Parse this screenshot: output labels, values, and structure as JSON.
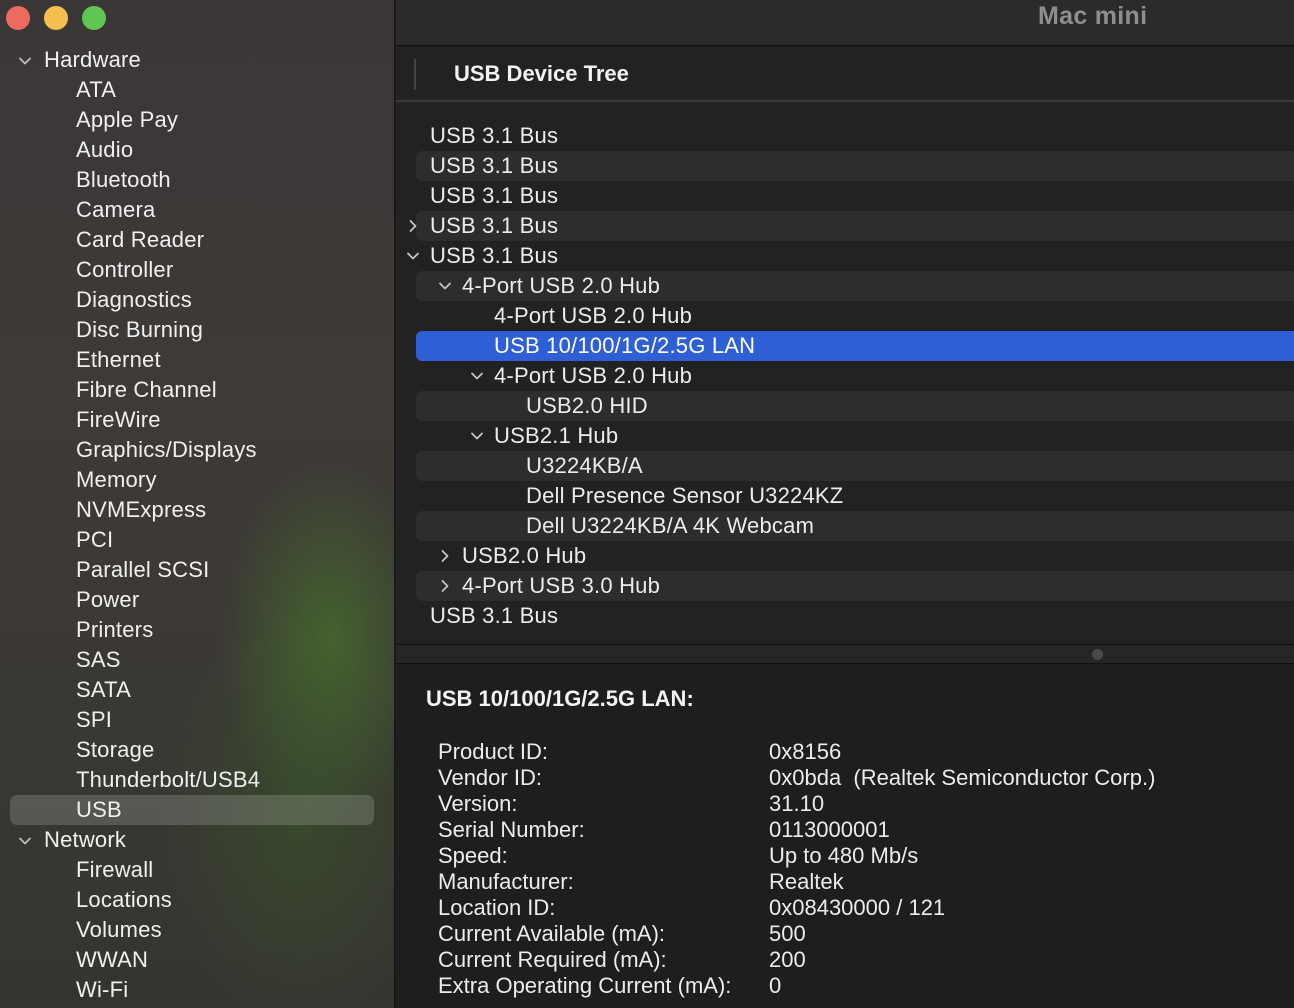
{
  "window": {
    "title": "Mac mini"
  },
  "sidebar": {
    "sections": [
      {
        "label": "Hardware",
        "items": [
          "ATA",
          "Apple Pay",
          "Audio",
          "Bluetooth",
          "Camera",
          "Card Reader",
          "Controller",
          "Diagnostics",
          "Disc Burning",
          "Ethernet",
          "Fibre Channel",
          "FireWire",
          "Graphics/Displays",
          "Memory",
          "NVMExpress",
          "PCI",
          "Parallel SCSI",
          "Power",
          "Printers",
          "SAS",
          "SATA",
          "SPI",
          "Storage",
          "Thunderbolt/USB4",
          "USB"
        ]
      },
      {
        "label": "Network",
        "items": [
          "Firewall",
          "Locations",
          "Volumes",
          "WWAN",
          "Wi-Fi"
        ]
      }
    ],
    "selected": "USB"
  },
  "tree": {
    "header": "USB Device Tree",
    "rows": [
      {
        "label": "USB 3.1 Bus",
        "level": 0,
        "toggle": "none"
      },
      {
        "label": "USB 3.1 Bus",
        "level": 0,
        "toggle": "none"
      },
      {
        "label": "USB 3.1 Bus",
        "level": 0,
        "toggle": "none"
      },
      {
        "label": "USB 3.1 Bus",
        "level": 0,
        "toggle": "collapsed"
      },
      {
        "label": "USB 3.1 Bus",
        "level": 0,
        "toggle": "expanded"
      },
      {
        "label": "4-Port USB 2.0 Hub",
        "level": 1,
        "toggle": "expanded"
      },
      {
        "label": "4-Port USB 2.0 Hub",
        "level": 2,
        "toggle": "none"
      },
      {
        "label": "USB 10/100/1G/2.5G LAN",
        "level": 2,
        "toggle": "none",
        "selected": true
      },
      {
        "label": "4-Port USB 2.0 Hub",
        "level": 2,
        "toggle": "expanded"
      },
      {
        "label": "USB2.0 HID",
        "level": 3,
        "toggle": "none"
      },
      {
        "label": "USB2.1 Hub",
        "level": 2,
        "toggle": "expanded"
      },
      {
        "label": "U3224KB/A",
        "level": 3,
        "toggle": "none"
      },
      {
        "label": "Dell Presence Sensor U3224KZ",
        "level": 3,
        "toggle": "none"
      },
      {
        "label": "Dell U3224KB/A 4K Webcam",
        "level": 3,
        "toggle": "none"
      },
      {
        "label": "USB2.0 Hub",
        "level": 1,
        "toggle": "collapsed"
      },
      {
        "label": "4-Port USB 3.0 Hub",
        "level": 1,
        "toggle": "collapsed"
      },
      {
        "label": "USB 3.1 Bus",
        "level": 0,
        "toggle": "none"
      }
    ]
  },
  "detail": {
    "title": "USB 10/100/1G/2.5G LAN:",
    "properties": [
      {
        "key": "Product ID:",
        "value": "0x8156"
      },
      {
        "key": "Vendor ID:",
        "value": "0x0bda  (Realtek Semiconductor Corp.)"
      },
      {
        "key": "Version:",
        "value": "31.10"
      },
      {
        "key": "Serial Number:",
        "value": "0113000001"
      },
      {
        "key": "Speed:",
        "value": "Up to 480 Mb/s"
      },
      {
        "key": "Manufacturer:",
        "value": "Realtek"
      },
      {
        "key": "Location ID:",
        "value": "0x08430000 / 121"
      },
      {
        "key": "Current Available (mA):",
        "value": "500"
      },
      {
        "key": "Current Required (mA):",
        "value": "200"
      },
      {
        "key": "Extra Operating Current (mA):",
        "value": "0"
      }
    ]
  },
  "colors": {
    "selection_blue": "#2f5fd5",
    "close": "#ed6a5e",
    "minimize": "#f5bf4f",
    "maximize": "#61c554"
  }
}
